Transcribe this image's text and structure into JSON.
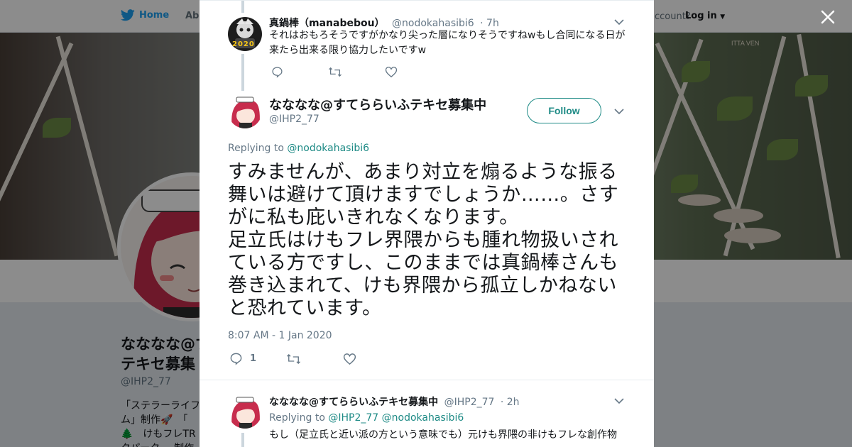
{
  "background": {
    "nav": {
      "home_label": "Home",
      "about_label": "Abo",
      "account_question": "ccount?",
      "login_label": "Log in"
    },
    "profile": {
      "name_line1": "なななな@す",
      "name_line2": "テキセ募集",
      "handle": "@IHP2_77",
      "bio_line1": "「ステラーライフ",
      "bio_line2": "ム」制作🚀　「",
      "bio_line3": "🌲　けもフレTR",
      "bio_line4": "クパーク。。制作"
    },
    "banner_sign": "ITTA VEN"
  },
  "modal": {
    "prev_tweet": {
      "name": "真鍋棒（manabebou）",
      "handle": "@nodokahasibi6",
      "time": "· 7h",
      "avatar_badge": "2020",
      "text": "それはおもろそうですがかなり尖った層になりそうですねwもし合同になる日が来たら出来る限り協力したいですw",
      "reply_count": "",
      "retweet_count": "",
      "like_count": ""
    },
    "main_tweet": {
      "name": "なななな@すてららいふテキセ募集中",
      "handle": "@IHP2_77",
      "follow_label": "Follow",
      "replying_prefix": "Replying to ",
      "replying_to": "@nodokahasibi6",
      "text_line1": "すみませんが、あまり対立を煽るような振る舞いは避けて頂けますでしょうか……。さすがに私も庇いきれなくなります。",
      "text_line2": "足立氏はけもフレ界隈からも腫れ物扱いされている方ですし、このままでは真鍋棒さんも巻き込まれて、けも界隈から孤立しかねないと恐れています。",
      "date": "8:07 AM - 1 Jan 2020",
      "reply_count": "1",
      "retweet_count": "",
      "like_count": ""
    },
    "next_tweet": {
      "name": "なななな@すてららいふテキセ募集中",
      "handle": "@IHP2_77",
      "time": "· 2h",
      "replying_prefix": "Replying to ",
      "replying_to": "@IHP2_77 @nodokahasibi6",
      "text": "もし（足立氏と近い派の方という意味でも）元けも界隈の非けもフレな創作物"
    }
  },
  "colors": {
    "accent": "#1d8a85",
    "twitter_blue": "#1da1f2",
    "muted": "#657786"
  }
}
